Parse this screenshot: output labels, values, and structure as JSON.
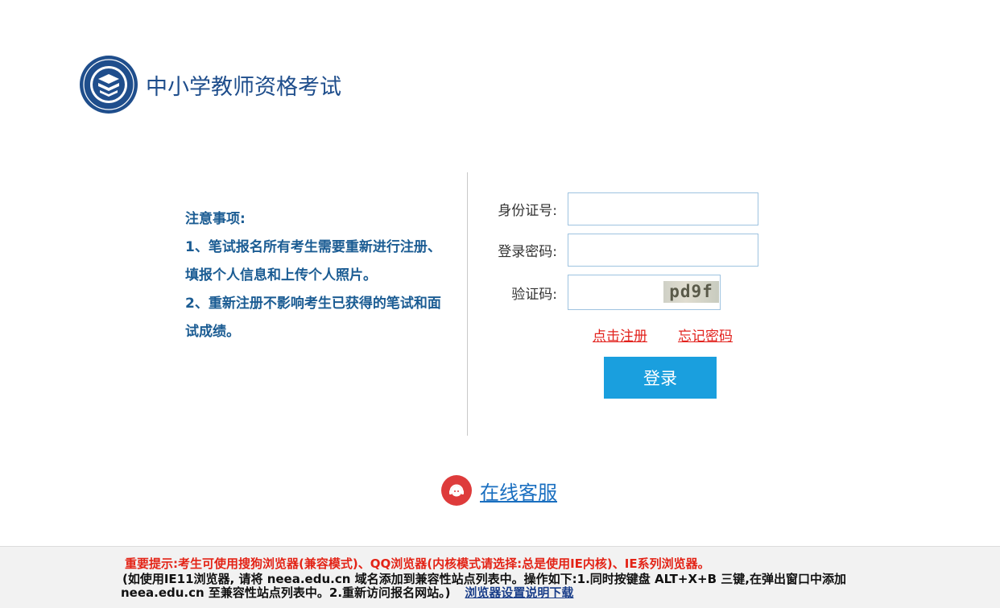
{
  "header": {
    "logo_icon": "education-emblem-icon",
    "title": "中小学教师资格考试"
  },
  "notice": {
    "title": "注意事项:",
    "items": [
      "1、笔试报名所有考生需要重新进行注册、填报个人信息和上传个人照片。",
      "2、重新注册不影响考生已获得的笔试和面试成绩。"
    ]
  },
  "login_form": {
    "id_label": "身份证号:",
    "id_value": "",
    "password_label": "登录密码:",
    "password_value": "",
    "captcha_label": "验证码:",
    "captcha_value": "",
    "captcha_image_text": "pd9f",
    "register_link": "点击注册",
    "forgot_link": "忘记密码",
    "login_button": "登录"
  },
  "customer_service": {
    "icon": "customer-service-headset-icon",
    "label": "在线客服"
  },
  "footer": {
    "line1": "重要提示:考生可使用搜狗浏览器(兼容模式)、QQ浏览器(内核模式请选择:总是使用IE内核)、IE系列浏览器。",
    "line2": "(如使用IE11浏览器, 请将 neea.edu.cn 域名添加到兼容性站点列表中。操作如下:1.同时按键盘 ALT+X+B 三键,在弹出窗口中添加",
    "line3": "neea.edu.cn 至兼容性站点列表中。2.重新访问报名网站。)",
    "settings_link": "浏览器设置说明下载"
  },
  "colors": {
    "brand_blue": "#1f4e8c",
    "notice_blue": "#1b5c93",
    "button_blue": "#1a9fde",
    "link_red": "#e2211c",
    "warning_red": "#e32417"
  }
}
